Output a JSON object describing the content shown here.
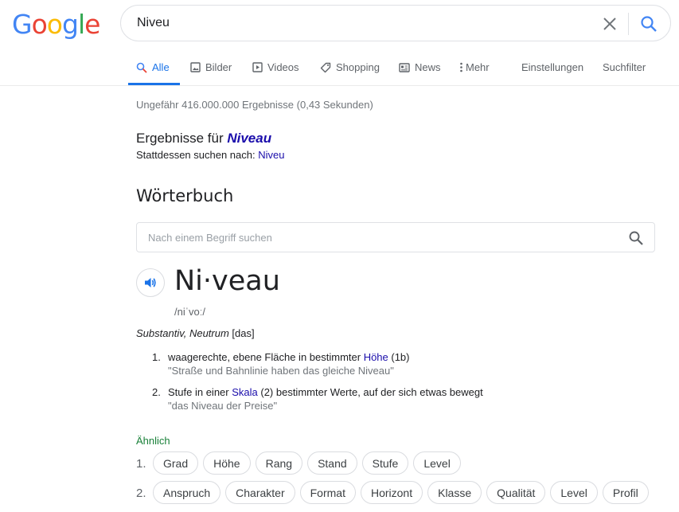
{
  "logo": {
    "letters": [
      "G",
      "o",
      "o",
      "g",
      "l",
      "e"
    ]
  },
  "search": {
    "query": "Niveu"
  },
  "tabs": [
    {
      "label": "Alle",
      "icon": "search-icon"
    },
    {
      "label": "Bilder",
      "icon": "image-icon"
    },
    {
      "label": "Videos",
      "icon": "video-icon"
    },
    {
      "label": "Shopping",
      "icon": "tag-icon"
    },
    {
      "label": "News",
      "icon": "news-icon"
    },
    {
      "label": "Mehr",
      "icon": "more-vert-icon"
    },
    {
      "label": "Einstellungen"
    },
    {
      "label": "Suchfilter"
    }
  ],
  "stats": "Ungefähr 416.000.000 Ergebnisse (0,43 Sekunden)",
  "correction": {
    "prefix": "Ergebnisse für ",
    "corrected": "Niveau",
    "instead_prefix": "Stattdessen suchen nach: ",
    "original": "Niveu"
  },
  "dictionary": {
    "title": "Wörterbuch",
    "search_placeholder": "Nach einem Begriff suchen",
    "headword": "Ni·veau",
    "phonetic": "/niˈvoː/",
    "pos_italic": "Substantiv, Neutrum",
    "pos_article": " [das]",
    "definitions": [
      {
        "num": "1.",
        "before": "waagerechte, ebene Fläche in bestimmter ",
        "link": "Höhe",
        "after": " (1b)",
        "example": "\"Straße und Bahnlinie haben das gleiche Niveau\""
      },
      {
        "num": "2.",
        "before": "Stufe in einer ",
        "link": "Skala",
        "after": " (2) bestimmter Werte, auf der sich etwas bewegt",
        "example": "\"das Niveau der Preise\""
      }
    ],
    "similar_label": "Ähnlich",
    "similar_rows": [
      {
        "num": "1.",
        "words": [
          "Grad",
          "Höhe",
          "Rang",
          "Stand",
          "Stufe",
          "Level"
        ]
      },
      {
        "num": "2.",
        "words": [
          "Anspruch",
          "Charakter",
          "Format",
          "Horizont",
          "Klasse",
          "Qualität",
          "Level",
          "Profil"
        ]
      }
    ]
  },
  "colors": {
    "accent": "#1a73e8",
    "link": "#1a0dab",
    "similar": "#188038"
  }
}
